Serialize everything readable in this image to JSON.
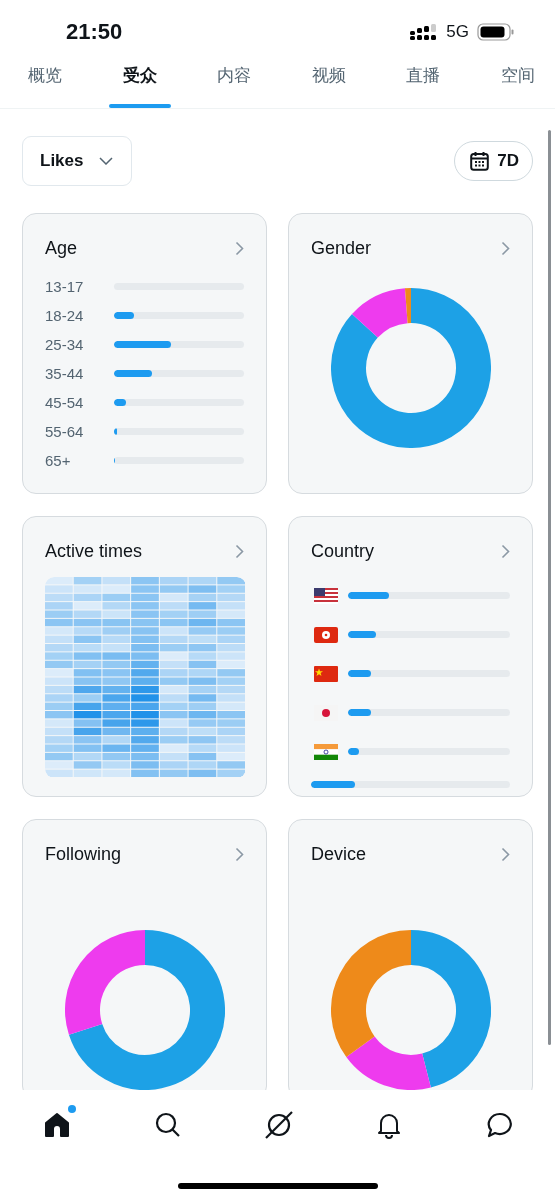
{
  "status_bar": {
    "time": "21:50",
    "network": "5G"
  },
  "tabs": [
    {
      "label": "概览",
      "selected": false
    },
    {
      "label": "受众",
      "selected": true
    },
    {
      "label": "内容",
      "selected": false
    },
    {
      "label": "视频",
      "selected": false
    },
    {
      "label": "直播",
      "selected": false
    },
    {
      "label": "空间",
      "selected": false
    }
  ],
  "filters": {
    "metric": "Likes",
    "period": "7D"
  },
  "cards": [
    {
      "kind": "bars",
      "title": "Age",
      "rows": [
        {
          "label": "13-17",
          "level": 0
        },
        {
          "label": "18-24",
          "level": 0.15
        },
        {
          "label": "25-34",
          "level": 0.44
        },
        {
          "label": "35-44",
          "level": 0.29
        },
        {
          "label": "45-54",
          "level": 0.09
        },
        {
          "label": "55-64",
          "level": 0.02
        },
        {
          "label": "65+",
          "level": 0.01
        }
      ]
    },
    {
      "kind": "donut",
      "title": "Gender",
      "segments": [
        {
          "color": "#1da1e6"
        },
        {
          "color": "#ee3bee"
        },
        {
          "color": "#ee8a1a"
        }
      ]
    },
    {
      "kind": "heatmap",
      "title": "Active times"
    },
    {
      "kind": "flags",
      "title": "Country",
      "rows": [
        {
          "kind": "us",
          "level": 0.25
        },
        {
          "kind": "hk",
          "level": 0.17
        },
        {
          "kind": "cn",
          "level": 0.14
        },
        {
          "kind": "jp",
          "level": 0.14
        },
        {
          "kind": "in",
          "level": 0.07
        },
        {
          "kind": "plain",
          "level": 0.22
        }
      ]
    },
    {
      "kind": "donut",
      "title": "Following",
      "segments": [
        {
          "color": "#1da1e6"
        },
        {
          "color": "#ee3bee"
        }
      ]
    },
    {
      "kind": "donut",
      "title": "Device",
      "segments": [
        {
          "color": "#1da1e6"
        },
        {
          "color": "#ee3bee"
        },
        {
          "color": "#ee8a1a"
        }
      ]
    }
  ],
  "nav": [
    {
      "kind": "home",
      "selected": true,
      "badge": true
    },
    {
      "kind": "search",
      "selected": false,
      "badge": false
    },
    {
      "kind": "slash",
      "selected": false,
      "badge": false
    },
    {
      "kind": "bell",
      "selected": false,
      "badge": false
    },
    {
      "kind": "chat",
      "selected": false,
      "badge": false
    }
  ]
}
